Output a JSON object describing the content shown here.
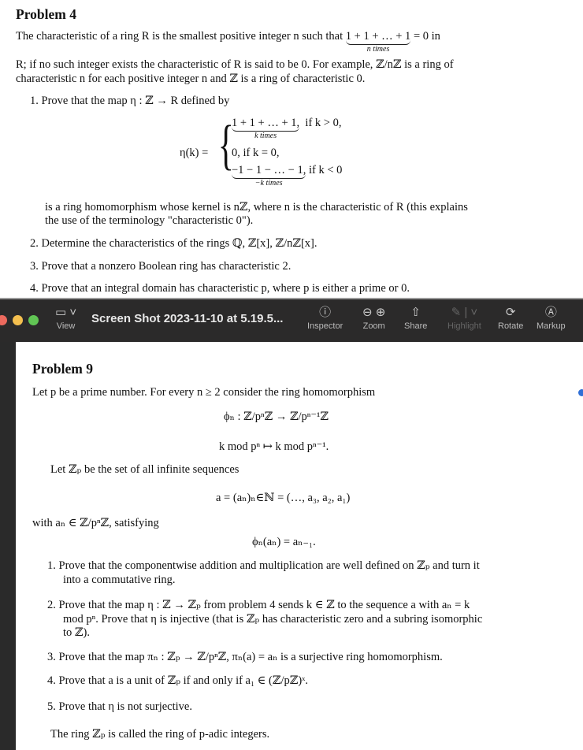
{
  "problem4": {
    "title": "Problem 4",
    "p1a": "The characteristic of a ring R is the smallest positive integer n such that",
    "p1_sum": "1 + 1 + … + 1",
    "p1_under": "n times",
    "p1b": "= 0 in",
    "p2": "R; if no such integer exists the characteristic of R is said to be 0. For example, ℤ/nℤ is a ring of",
    "p3": "characteristic n for each positive integer n and ℤ is a ring of characteristic 0.",
    "item1": "1. Prove that the map η : ℤ → R defined by",
    "eta": "η(k) =",
    "case1": "1 + 1 + … + 1,",
    "case1_under": "k times",
    "case1_cond": "if k > 0,",
    "case2": "0,   if k = 0,",
    "case3": "−1 − 1 − … − 1,",
    "case3_under": "−k times",
    "case3_cond": "if k < 0",
    "item1b": "is a ring homomorphism whose kernel is nℤ, where n is the characteristic of R (this explains",
    "item1c": "the use of the terminology \"characteristic 0\").",
    "item2": "2. Determine the characteristics of the rings ℚ, ℤ[x], ℤ/nℤ[x].",
    "item3": "3. Prove that a nonzero Boolean ring has characteristic 2.",
    "item4": "4. Prove that an integral domain has characteristic p, where p is either a prime or 0."
  },
  "toolbar": {
    "view": "View",
    "title": "Screen Shot 2023-11-10 at 5.19.5...",
    "inspector": "Inspector",
    "zoom": "Zoom",
    "share": "Share",
    "highlight": "Highlight",
    "rotate": "Rotate",
    "markup": "Markup",
    "colors": {
      "close": "#ed6a5e",
      "minimize": "#f4bf4f",
      "maximize": "#61c554"
    }
  },
  "problem9": {
    "title": "Problem 9",
    "l1": "Let p be a prime number. For every n ≥ 2 consider the ring homomorphism",
    "m1": "ϕₙ : ℤ/pⁿℤ → ℤ/pⁿ⁻¹ℤ",
    "m2": "k  mod pⁿ ↦ k  mod pⁿ⁻¹.",
    "l2": "Let ℤₚ be the set of all infinite sequences",
    "m3": "a = (aₙ)ₙ∈ℕ = (…, a₃, a₂, a₁)",
    "l3": "with aₙ ∈ ℤ/pⁿℤ, satisfying",
    "m4": "ϕₙ(aₙ) = aₙ₋₁.",
    "i1a": "1. Prove that the componentwise addition and multiplication are well defined on ℤₚ and turn it",
    "i1b": "into a commutative ring.",
    "i2a": "2. Prove that the map η : ℤ → ℤₚ from problem 4 sends k ∈ ℤ to the sequence a with aₙ = k",
    "i2b": "mod pⁿ. Prove that η is injective (that is ℤₚ has characteristic zero and a subring isomorphic",
    "i2c": "to ℤ).",
    "i3": "3. Prove that the map πₙ : ℤₚ → ℤ/pⁿℤ,  πₙ(a) = aₙ is a surjective ring homomorphism.",
    "i4": "4. Prove that a is a unit of ℤₚ if and only if a₁ ∈ (ℤ/pℤ)ˣ.",
    "i5": "5. Prove that η is not surjective.",
    "closing": "The ring ℤₚ is called the ring of p-adic integers."
  }
}
